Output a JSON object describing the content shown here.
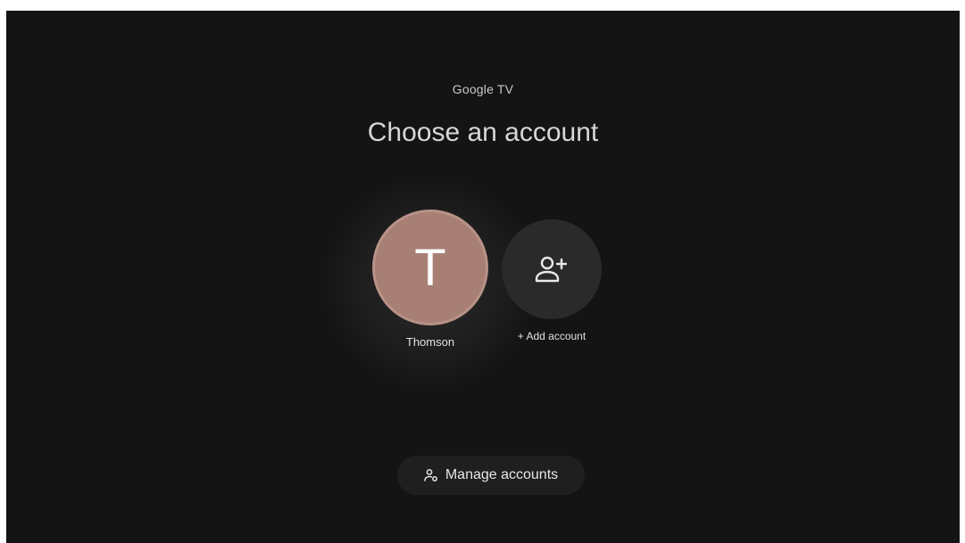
{
  "header": {
    "brand": "Google TV",
    "title": "Choose an account"
  },
  "accounts": [
    {
      "initial": "T",
      "name": "Thomson",
      "avatar_color": "#a77f74"
    }
  ],
  "add_account": {
    "label": "+ Add account",
    "icon": "add-person-icon"
  },
  "manage": {
    "label": "Manage accounts",
    "icon": "manage-accounts-icon"
  },
  "colors": {
    "background": "#141414",
    "tile_background": "#2a2a2a",
    "text": "#d7d7d7"
  }
}
